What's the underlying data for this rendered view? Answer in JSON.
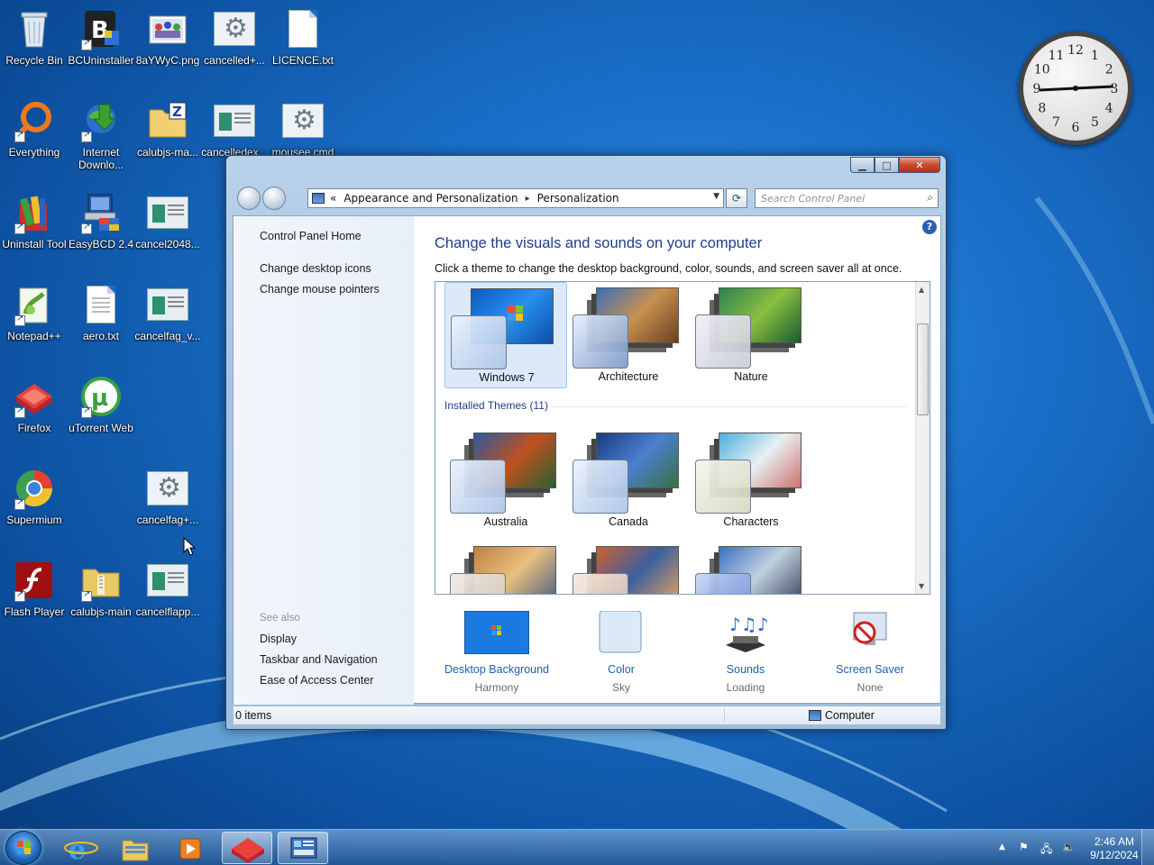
{
  "desktop": {
    "icons": [
      {
        "label": "Recycle Bin"
      },
      {
        "label": "BCUninstaller"
      },
      {
        "label": "8aYWyC.png"
      },
      {
        "label": "cancelled+..."
      },
      {
        "label": "LICENCE.txt"
      },
      {
        "label": "Everything"
      },
      {
        "label": "Internet Downlo..."
      },
      {
        "label": "calubjs-ma..."
      },
      {
        "label": "cancelledex..."
      },
      {
        "label": "mousee.cmd"
      },
      {
        "label": "Uninstall Tool"
      },
      {
        "label": "EasyBCD 2.4"
      },
      {
        "label": "cancel2048..."
      },
      {
        "label": "Notepad++"
      },
      {
        "label": "aero.txt"
      },
      {
        "label": "cancelfag_v..."
      },
      {
        "label": "Firefox"
      },
      {
        "label": "uTorrent Web"
      },
      {
        "label": "Supermium"
      },
      {
        "label": "cancelfag+..."
      },
      {
        "label": "Flash Player"
      },
      {
        "label": "calubjs-main"
      },
      {
        "label": "cancelflapp..."
      }
    ],
    "clock_gadget": {
      "numbers": [
        "12",
        "1",
        "2",
        "3",
        "4",
        "5",
        "6",
        "7",
        "8",
        "9",
        "10",
        "11"
      ]
    }
  },
  "window": {
    "address": {
      "chevron": "«",
      "crumbs": [
        "Appearance and Personalization",
        "Personalization"
      ],
      "separator": "▸"
    },
    "search_placeholder": "Search Control Panel",
    "left_pane": {
      "home": "Control Panel Home",
      "links": [
        "Change desktop icons",
        "Change mouse pointers"
      ],
      "see_also_title": "See also",
      "see_also": [
        "Display",
        "Taskbar and Navigation",
        "Ease of Access Center"
      ]
    },
    "heading": "Change the visuals and sounds on your computer",
    "subheading": "Click a theme to change the desktop background, color, sounds, and screen saver all at once.",
    "themes_top": [
      {
        "name": "Windows 7",
        "selected": true
      },
      {
        "name": "Architecture",
        "selected": false
      },
      {
        "name": "Nature",
        "selected": false
      }
    ],
    "installed_group": "Installed Themes (11)",
    "themes_installed": [
      {
        "name": "Australia"
      },
      {
        "name": "Canada"
      },
      {
        "name": "Characters"
      }
    ],
    "settings": [
      {
        "name": "Desktop Background",
        "value": "Harmony"
      },
      {
        "name": "Color",
        "value": "Sky"
      },
      {
        "name": "Sounds",
        "value": "Loading"
      },
      {
        "name": "Screen Saver",
        "value": "None"
      }
    ],
    "status": {
      "items": "0 items",
      "location": "Computer"
    }
  },
  "taskbar": {
    "time": "2:46 AM",
    "date": "9/12/2024"
  },
  "colors": {
    "accent": "#1e3d8a",
    "link": "#1f5fb0",
    "selection": "#dbe9fb"
  }
}
